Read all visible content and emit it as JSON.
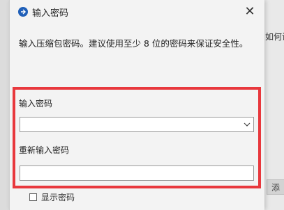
{
  "dialog": {
    "title": "输入密码",
    "description": "输入压缩包密码。建议使用至少 8 位的密码来保证安全性。",
    "close_glyph": "✕",
    "password_label": "输入密码",
    "password_value": "",
    "confirm_label": "重新输入密码",
    "confirm_value": "",
    "show_password_label": "显示密码",
    "show_password_checked": false
  },
  "background": {
    "partial_text": "如何设",
    "partial_button": "添"
  },
  "colors": {
    "highlight": "#e8383d",
    "title_icon": "#1f5fb8"
  },
  "icons": [
    "app-icon",
    "close-icon",
    "chevron-down-icon"
  ]
}
